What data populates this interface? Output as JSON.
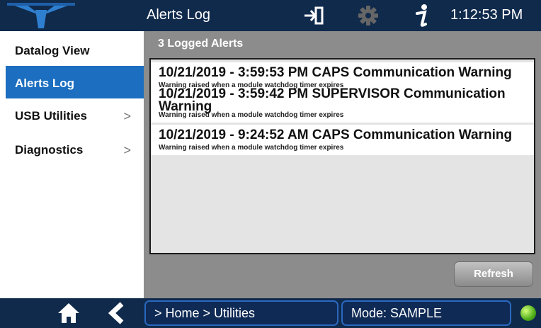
{
  "header": {
    "title": "Alerts Log",
    "clock": "1:12:53 PM",
    "icons": [
      "logo-icon",
      "exit-icon",
      "gear-icon",
      "info-icon"
    ]
  },
  "sidebar": {
    "items": [
      {
        "label": "Datalog View",
        "has_chevron": false,
        "active": false
      },
      {
        "label": "Alerts Log",
        "has_chevron": false,
        "active": true
      },
      {
        "label": "USB Utilities",
        "has_chevron": true,
        "active": false
      },
      {
        "label": "Diagnostics",
        "has_chevron": true,
        "active": false
      }
    ],
    "chevron": ">"
  },
  "main": {
    "header": "3 Logged Alerts",
    "alerts": [
      {
        "title": "10/21/2019 - 3:59:53 PM CAPS Communication Warning",
        "description": "Warning raised when a module watchdog timer expires"
      },
      {
        "title": "10/21/2019 - 3:59:42 PM SUPERVISOR Communication Warning",
        "description": "Warning raised when a module watchdog timer expires"
      },
      {
        "title": "10/21/2019 - 9:24:52 AM CAPS Communication Warning",
        "description": "Warning raised when a module watchdog timer expires"
      }
    ],
    "refresh_label": "Refresh"
  },
  "footer": {
    "breadcrumb": "> Home > Utilities",
    "mode": "Mode: SAMPLE",
    "status_color": "#4fae1c"
  },
  "colors": {
    "bar": "#102a4c",
    "accent": "#1b6ec0",
    "panel": "#8c8c8c"
  }
}
